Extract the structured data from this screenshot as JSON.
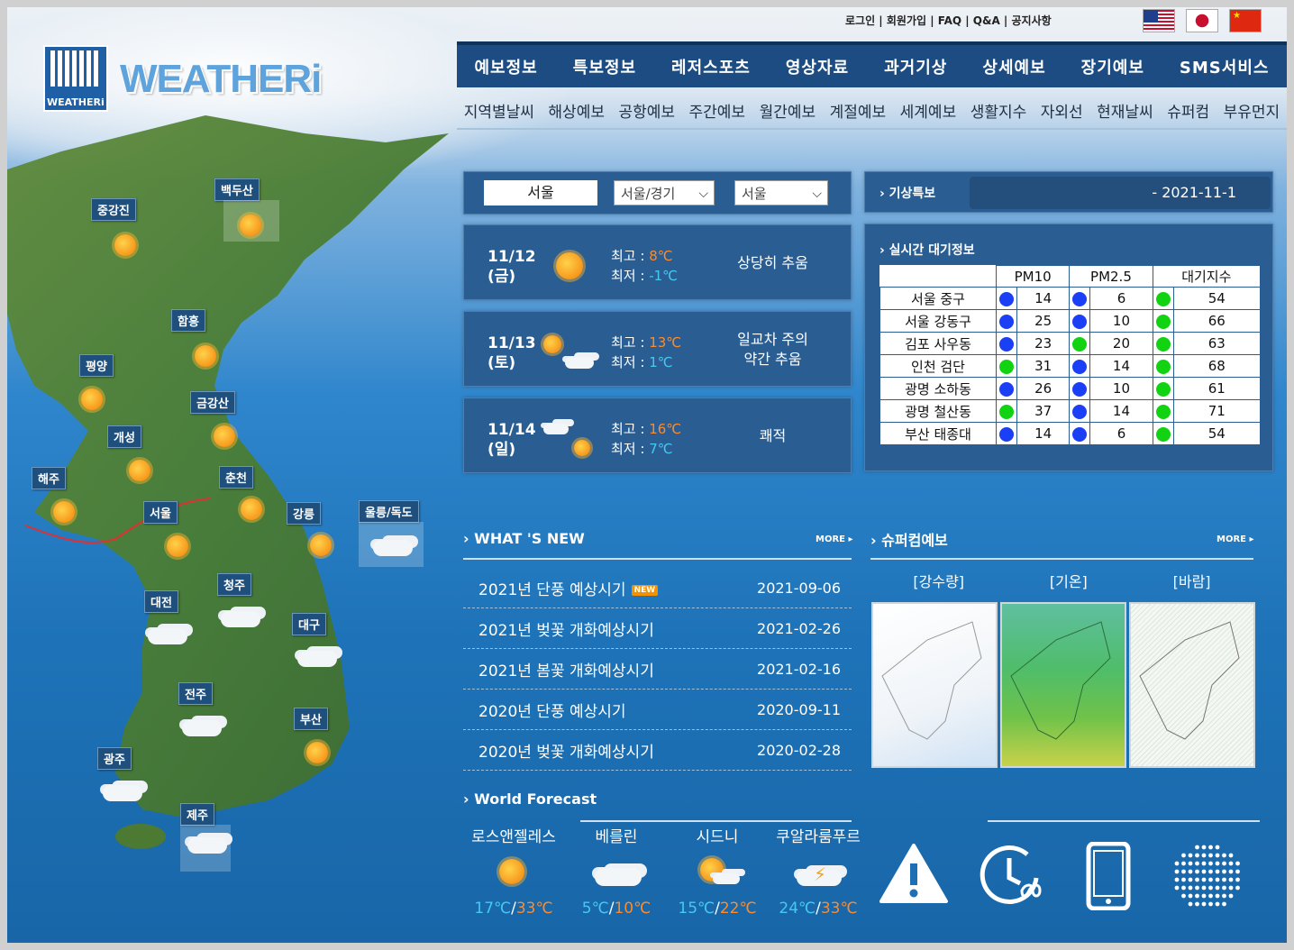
{
  "header": {
    "logo_badge": "WEATHERi",
    "logo_text": "WEATHERi",
    "top_links": "로그인 | 회원가입 | FAQ | Q&A | 공지사항",
    "flags": [
      "us-flag",
      "japan-flag",
      "china-flag"
    ]
  },
  "main_nav": [
    "예보정보",
    "특보정보",
    "레저스포츠",
    "영상자료",
    "과거기상",
    "상세예보",
    "장기예보",
    "SMS서비스"
  ],
  "sub_nav": [
    "지역별날씨",
    "해상예보",
    "공항예보",
    "주간예보",
    "월간예보",
    "계절예보",
    "세계예보",
    "생활지수",
    "자외선",
    "현재날씨",
    "슈퍼컴",
    "부유먼지"
  ],
  "map": {
    "cities": [
      {
        "name": "백두산",
        "icon": "sun"
      },
      {
        "name": "중강진",
        "icon": "sun"
      },
      {
        "name": "함흥",
        "icon": "sun"
      },
      {
        "name": "평양",
        "icon": "sun"
      },
      {
        "name": "금강산",
        "icon": "sun"
      },
      {
        "name": "개성",
        "icon": "sun"
      },
      {
        "name": "해주",
        "icon": "sun"
      },
      {
        "name": "춘천",
        "icon": "sun"
      },
      {
        "name": "서울",
        "icon": "sun"
      },
      {
        "name": "강릉",
        "icon": "sun"
      },
      {
        "name": "울릉/독도",
        "icon": "cloud"
      },
      {
        "name": "청주",
        "icon": "cloud"
      },
      {
        "name": "대전",
        "icon": "cloud"
      },
      {
        "name": "대구",
        "icon": "cloud"
      },
      {
        "name": "전주",
        "icon": "cloud"
      },
      {
        "name": "부산",
        "icon": "sun"
      },
      {
        "name": "광주",
        "icon": "cloud"
      },
      {
        "name": "제주",
        "icon": "rain"
      }
    ]
  },
  "selector": {
    "city": "서울",
    "region": "서울/경기",
    "district": "서울"
  },
  "forecast": [
    {
      "date": "11/12",
      "day": "(금)",
      "hi_label": "최고 : ",
      "hi": "8℃",
      "lo_label": "최저 : ",
      "lo": "-1℃",
      "desc1": "상당히 추움",
      "desc2": "",
      "icon": "sun"
    },
    {
      "date": "11/13",
      "day": "(토)",
      "hi_label": "최고 : ",
      "hi": "13℃",
      "lo_label": "최저 : ",
      "lo": "1℃",
      "desc1": "일교차 주의",
      "desc2": "약간 추움",
      "icon": "sun-then-cloud"
    },
    {
      "date": "11/14",
      "day": "(일)",
      "hi_label": "최고 : ",
      "hi": "16℃",
      "lo_label": "최저 : ",
      "lo": "7℃",
      "desc1": "쾌적",
      "desc2": "",
      "icon": "rain-then-sun"
    }
  ],
  "alert": {
    "title": "기상특보",
    "date": "- 2021-11-1"
  },
  "air": {
    "title": "실시간 대기정보",
    "headers": [
      "PM10",
      "PM2.5",
      "대기지수"
    ],
    "rows": [
      {
        "name": "서울 중구",
        "pm10": "14",
        "pm10c": "b",
        "pm25": "6",
        "pm25c": "b",
        "idx": "54",
        "idxc": "g"
      },
      {
        "name": "서울 강동구",
        "pm10": "25",
        "pm10c": "b",
        "pm25": "10",
        "pm25c": "b",
        "idx": "66",
        "idxc": "g"
      },
      {
        "name": "김포 사우동",
        "pm10": "23",
        "pm10c": "b",
        "pm25": "20",
        "pm25c": "g",
        "idx": "63",
        "idxc": "g"
      },
      {
        "name": "인천 검단",
        "pm10": "31",
        "pm10c": "g",
        "pm25": "14",
        "pm25c": "b",
        "idx": "68",
        "idxc": "g"
      },
      {
        "name": "광명 소하동",
        "pm10": "26",
        "pm10c": "b",
        "pm25": "10",
        "pm25c": "b",
        "idx": "61",
        "idxc": "g"
      },
      {
        "name": "광명 철산동",
        "pm10": "37",
        "pm10c": "g",
        "pm25": "14",
        "pm25c": "b",
        "idx": "71",
        "idxc": "g"
      },
      {
        "name": "부산 태종대",
        "pm10": "14",
        "pm10c": "b",
        "pm25": "6",
        "pm25c": "b",
        "idx": "54",
        "idxc": "g"
      }
    ]
  },
  "news": {
    "title": "WHAT 'S NEW",
    "more": "MORE ▸",
    "items": [
      {
        "title": "2021년 단풍 예상시기",
        "date": "2021-09-06",
        "badge": "NEW"
      },
      {
        "title": "2021년 벚꽃 개화예상시기",
        "date": "2021-02-26",
        "badge": ""
      },
      {
        "title": "2021년 봄꽃 개화예상시기",
        "date": "2021-02-16",
        "badge": ""
      },
      {
        "title": "2020년 단풍 예상시기",
        "date": "2020-09-11",
        "badge": ""
      },
      {
        "title": "2020년 벚꽃 개화예상시기",
        "date": "2020-02-28",
        "badge": ""
      }
    ]
  },
  "supercom": {
    "title": "슈퍼컴예보",
    "more": "MORE ▸",
    "labels": [
      "[강수량]",
      "[기온]",
      "[바람]"
    ]
  },
  "world": {
    "title": "World Forecast",
    "cities": [
      {
        "name": "로스앤젤레스",
        "lo": "17℃",
        "hi": "33℃",
        "icon": "sun"
      },
      {
        "name": "베를린",
        "lo": "5℃",
        "hi": "10℃",
        "icon": "cloud"
      },
      {
        "name": "시드니",
        "lo": "15℃",
        "hi": "22℃",
        "icon": "sun-cloud"
      },
      {
        "name": "쿠알라룸푸르",
        "lo": "24℃",
        "hi": "33℃",
        "icon": "thunder"
      }
    ],
    "sep": "/"
  },
  "colors": {
    "nav": "#1c4c82",
    "hi": "#ff8a2b",
    "lo": "#46c9f0",
    "good": "#12d312",
    "verygood": "#1b3ff5"
  }
}
